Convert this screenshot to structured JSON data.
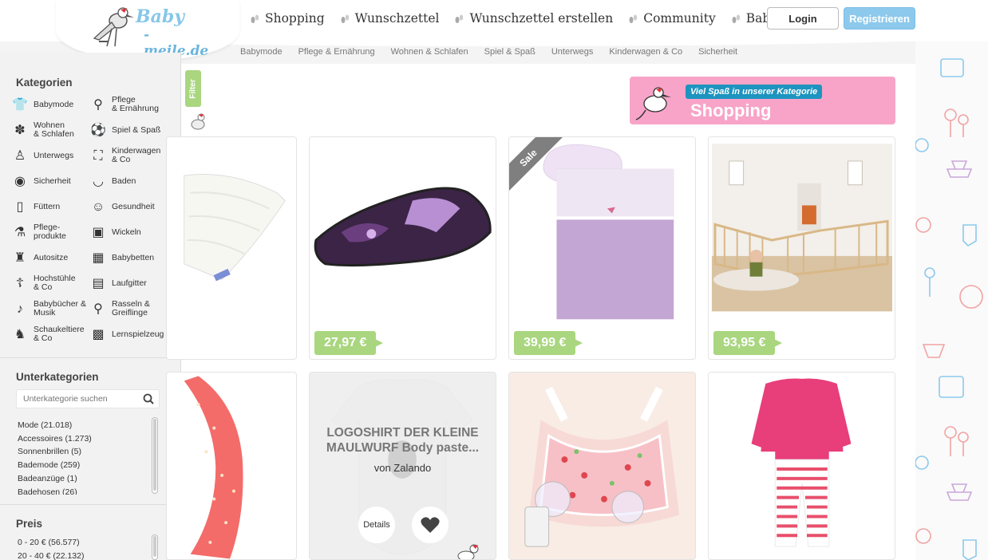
{
  "logo": {
    "line1": "Baby",
    "line2": "- meile.de"
  },
  "main_nav": [
    "Shopping",
    "Wunschzettel",
    "Wunschzettel erstellen",
    "Community",
    "Babymagazin"
  ],
  "auth": {
    "login": "Login",
    "register": "Registrieren"
  },
  "sub_nav": [
    "Babymode",
    "Pflege & Ernährung",
    "Wohnen & Schlafen",
    "Spiel & Spaß",
    "Unterwegs",
    "Kinderwagen & Co",
    "Sicherheit"
  ],
  "sidebar": {
    "categories_title": "Kategorien",
    "categories": [
      {
        "label": "Babymode",
        "icon": "onesie-icon"
      },
      {
        "label": "Pflege\n& Ernährung",
        "icon": "bib-icon"
      },
      {
        "label": "Wohnen\n& Schlafen",
        "icon": "teddy-icon"
      },
      {
        "label": "Spiel & Spaß",
        "icon": "ball-icon"
      },
      {
        "label": "Unterwegs",
        "icon": "family-icon"
      },
      {
        "label": "Kinderwagen\n& Co",
        "icon": "stroller-icon"
      },
      {
        "label": "Sicherheit",
        "icon": "pacifier-icon"
      },
      {
        "label": "Baden",
        "icon": "bathtub-icon"
      },
      {
        "label": "Füttern",
        "icon": "bottle-icon"
      },
      {
        "label": "Gesundheit",
        "icon": "baby-face-icon"
      },
      {
        "label": "Pflege-\nprodukte",
        "icon": "lotion-icon"
      },
      {
        "label": "Wickeln",
        "icon": "diaper-icon"
      },
      {
        "label": "Autositze",
        "icon": "car-seat-icon"
      },
      {
        "label": "Babybetten",
        "icon": "crib-icon"
      },
      {
        "label": "Hochstühle\n& Co",
        "icon": "high-chair-icon"
      },
      {
        "label": "Laufgitter",
        "icon": "playpen-icon"
      },
      {
        "label": "Babybücher &\nMusik",
        "icon": "music-note-icon"
      },
      {
        "label": "Rasseln &\nGreiflinge",
        "icon": "rattle-icon"
      },
      {
        "label": "Schaukeltiere\n& Co",
        "icon": "rocking-horse-icon"
      },
      {
        "label": "Lernspielzeug",
        "icon": "abc-blocks-icon"
      }
    ],
    "sub_title": "Unterkategorien",
    "sub_search_placeholder": "Unterkategorie suchen",
    "sub_items": [
      "Mode (21.018)",
      "Accessoires (1.273)",
      "Sonnenbrillen (5)",
      "Bademode (259)",
      "Badeanzüge (1)",
      "Badehosen (26)"
    ],
    "price_title": "Preis",
    "price_items": [
      "0 - 20 € (56.577)",
      "20 - 40 € (22.132)"
    ]
  },
  "filter_label": "Filter",
  "banner": {
    "tag": "Viel Spaß in unserer Kategorie",
    "title": "Shopping"
  },
  "products": [
    {
      "name": "blanket",
      "price": ""
    },
    {
      "name": "slipper",
      "price": "27,97 €"
    },
    {
      "name": "bedding",
      "price": "39,99 €",
      "badge": "Sale"
    },
    {
      "name": "playpen",
      "price": "93,95 €"
    },
    {
      "name": "scarf",
      "price": ""
    },
    {
      "name": "bodysuit",
      "price": "",
      "overlay_title": "LOGOSHIRT DER KLEINE MAULWURF Body paste...",
      "overlay_by": "von Zalando",
      "details": "Details"
    },
    {
      "name": "pump-bra",
      "price": ""
    },
    {
      "name": "pajama",
      "price": ""
    }
  ],
  "colors": {
    "accent_blue": "#8dc9ec",
    "price_green": "#a9d67f",
    "banner_pink": "#f7a4c8",
    "tag_blue": "#1d94bf"
  }
}
